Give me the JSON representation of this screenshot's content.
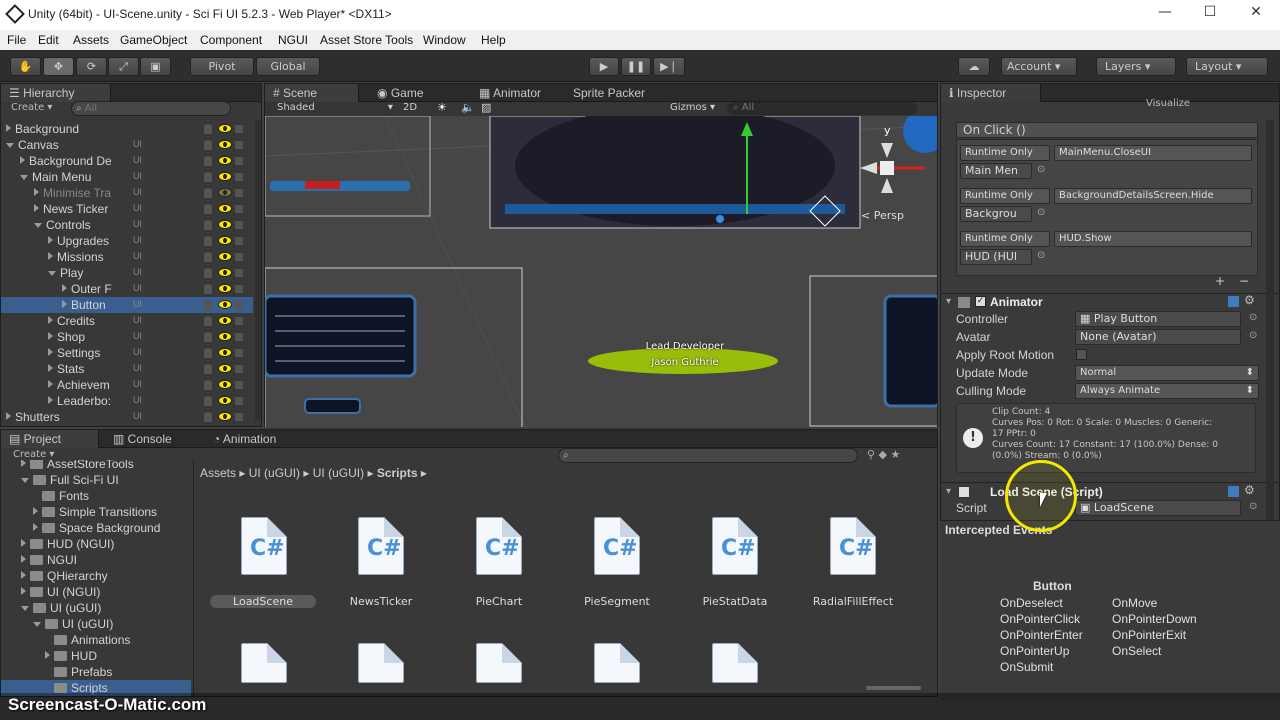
{
  "window": {
    "title": "Unity (64bit) - UI-Scene.unity - Sci Fi UI 5.2.3 - Web Player* <DX11>",
    "minimize": "—",
    "maximize": "☐",
    "close": "✕"
  },
  "menu": [
    "File",
    "Edit",
    "Assets",
    "GameObject",
    "Component",
    "NGUI",
    "Asset Store Tools",
    "Window",
    "Help"
  ],
  "toolbar": {
    "pivot": "Pivot",
    "global": "Global",
    "play": "▶",
    "pause": "❚❚",
    "step": "▶❘",
    "cloud": "☁",
    "account": "Account",
    "layers": "Layers",
    "layout": "Layout"
  },
  "hierarchy": {
    "tab": "Hierarchy",
    "create": "Create",
    "search_placeholder": "All",
    "items": [
      {
        "label": "Background",
        "indent": 0,
        "arrow": "closed",
        "tag": ""
      },
      {
        "label": "Canvas",
        "indent": 0,
        "arrow": "open",
        "tag": "UI"
      },
      {
        "label": "Background De",
        "indent": 1,
        "arrow": "closed",
        "tag": "UI"
      },
      {
        "label": "Main Menu",
        "indent": 1,
        "arrow": "open",
        "tag": "UI"
      },
      {
        "label": "Minimise Tra",
        "indent": 2,
        "arrow": "closed",
        "tag": "UI",
        "dim": true
      },
      {
        "label": "News Ticker",
        "indent": 2,
        "arrow": "closed",
        "tag": "UI"
      },
      {
        "label": "Controls",
        "indent": 2,
        "arrow": "open",
        "tag": "UI"
      },
      {
        "label": "Upgrades",
        "indent": 3,
        "arrow": "closed",
        "tag": "UI"
      },
      {
        "label": "Missions",
        "indent": 3,
        "arrow": "closed",
        "tag": "UI"
      },
      {
        "label": "Play",
        "indent": 3,
        "arrow": "open",
        "tag": "UI"
      },
      {
        "label": "Outer F",
        "indent": 4,
        "arrow": "closed",
        "tag": "UI"
      },
      {
        "label": "Button",
        "indent": 4,
        "arrow": "closed",
        "tag": "UI",
        "selected": true
      },
      {
        "label": "Credits",
        "indent": 3,
        "arrow": "closed",
        "tag": "UI"
      },
      {
        "label": "Shop",
        "indent": 3,
        "arrow": "closed",
        "tag": "UI"
      },
      {
        "label": "Settings",
        "indent": 3,
        "arrow": "closed",
        "tag": "UI"
      },
      {
        "label": "Stats",
        "indent": 3,
        "arrow": "closed",
        "tag": "UI"
      },
      {
        "label": "Achievem",
        "indent": 3,
        "arrow": "closed",
        "tag": "UI"
      },
      {
        "label": "Leaderbo:",
        "indent": 3,
        "arrow": "closed",
        "tag": "UI"
      },
      {
        "label": "Shutters",
        "indent": 0,
        "arrow": "closed",
        "tag": "UI"
      }
    ]
  },
  "scene": {
    "tabs": [
      "Scene",
      "Game",
      "Animator",
      "Sprite Packer"
    ],
    "shading": "Shaded",
    "mode2d": "2D",
    "gizmos": "Gizmos",
    "search_placeholder": "All",
    "persp": "Persp",
    "credit_title": "Lead Developer",
    "credit_name": "Jason Guthrie"
  },
  "project": {
    "tabs": [
      "Project",
      "Console",
      "Animation"
    ],
    "create": "Create",
    "breadcrumb": [
      "Assets",
      "UI (uGUI)",
      "UI (uGUI)",
      "Scripts"
    ],
    "tree": [
      {
        "label": "AssetStoreTools",
        "indent": 1,
        "arrow": "closed"
      },
      {
        "label": "Full Sci-Fi UI",
        "indent": 1,
        "arrow": "open"
      },
      {
        "label": "Fonts",
        "indent": 2,
        "arrow": ""
      },
      {
        "label": "Simple Transitions",
        "indent": 2,
        "arrow": "closed"
      },
      {
        "label": "Space Background",
        "indent": 2,
        "arrow": "closed"
      },
      {
        "label": "HUD (NGUI)",
        "indent": 1,
        "arrow": "closed"
      },
      {
        "label": "NGUI",
        "indent": 1,
        "arrow": "closed"
      },
      {
        "label": "QHierarchy",
        "indent": 1,
        "arrow": "closed"
      },
      {
        "label": "UI (NGUI)",
        "indent": 1,
        "arrow": "closed"
      },
      {
        "label": "UI (uGUI)",
        "indent": 1,
        "arrow": "open"
      },
      {
        "label": "UI (uGUI)",
        "indent": 2,
        "arrow": "open"
      },
      {
        "label": "Animations",
        "indent": 3,
        "arrow": ""
      },
      {
        "label": "HUD",
        "indent": 3,
        "arrow": "closed"
      },
      {
        "label": "Prefabs",
        "indent": 3,
        "arrow": ""
      },
      {
        "label": "Scripts",
        "indent": 3,
        "arrow": "",
        "selected": true
      }
    ],
    "assets": [
      "LoadScene",
      "NewsTicker",
      "PieChart",
      "PieSegment",
      "PieStatData",
      "RadialFillEffect"
    ],
    "cs_glyph": "C#"
  },
  "inspector": {
    "tab": "Inspector",
    "visualize": "Visualize",
    "onclick": "On Click ()",
    "events": [
      {
        "mode": "Runtime Only",
        "func": "MainMenu.CloseUI",
        "obj": "Main Men"
      },
      {
        "mode": "Runtime Only",
        "func": "BackgroundDetailsScreen.Hide",
        "obj": "Backgrou"
      },
      {
        "mode": "Runtime Only",
        "func": "HUD.Show",
        "obj": "HUD (HUI"
      }
    ],
    "plus": "+",
    "minus": "−",
    "animator": {
      "title": "Animator",
      "controller_label": "Controller",
      "controller": "Play Button",
      "avatar_label": "Avatar",
      "avatar": "None (Avatar)",
      "root_motion_label": "Apply Root Motion",
      "update_label": "Update Mode",
      "update": "Normal",
      "culling_label": "Culling Mode",
      "culling": "Always Animate",
      "info": [
        "Clip Count: 4",
        "Curves Pos: 0 Rot: 0 Scale: 0 Muscles: 0 Generic:",
        "17 PPtr: 0",
        "Curves Count: 17 Constant: 17 (100.0%) Dense: 0",
        "(0.0%) Stream: 0 (0.0%)"
      ]
    },
    "loadscene": {
      "title": "Load Scene (Script)",
      "script_label": "Script",
      "script": "LoadScene"
    },
    "intercepted": {
      "title": "Intercepted Events",
      "component": "Button",
      "left": [
        "OnDeselect",
        "OnPointerClick",
        "OnPointerEnter",
        "OnPointerUp",
        "OnSubmit"
      ],
      "right": [
        "OnMove",
        "OnPointerDown",
        "OnPointerExit",
        "OnSelect"
      ]
    }
  },
  "watermark": "Screencast-O-Matic.com",
  "colors": {
    "accent_yellow": "#ffe600",
    "selection": "#3a5f8f",
    "panel": "#383838"
  }
}
